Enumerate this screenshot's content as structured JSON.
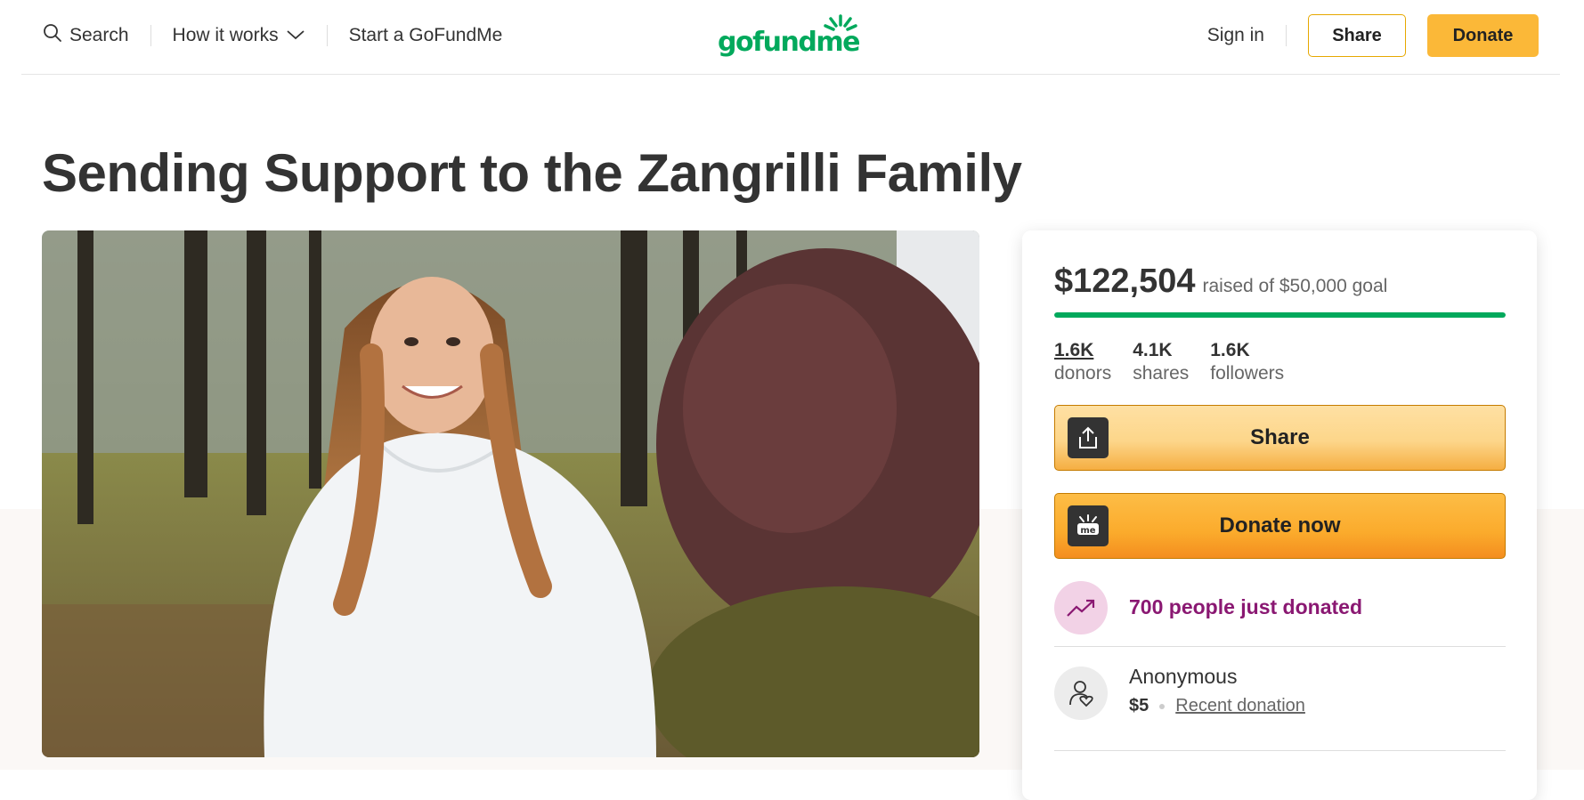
{
  "header": {
    "search_label": "Search",
    "how_it_works_label": "How it works",
    "start_label": "Start a GoFundMe",
    "logo_text": "gofundme",
    "signin_label": "Sign in",
    "share_label": "Share",
    "donate_label": "Donate"
  },
  "campaign": {
    "title": "Sending Support to the Zangrilli Family"
  },
  "card": {
    "amount_raised": "$122,504",
    "goal_text": "raised of $50,000 goal",
    "progress_fraction": 1.0,
    "progress_color": "#02a95c",
    "stats": [
      {
        "value": "1.6K",
        "label": "donors"
      },
      {
        "value": "4.1K",
        "label": "shares"
      },
      {
        "value": "1.6K",
        "label": "followers"
      }
    ],
    "share_button_label": "Share",
    "donate_button_label": "Donate now",
    "trend_text": "700 people just donated",
    "recent_donor": {
      "name": "Anonymous",
      "amount": "$5",
      "tag": "Recent donation"
    }
  },
  "colors": {
    "brand_green": "#02a95c",
    "donate_yellow": "#fbb838",
    "trend_purple": "#8a1872"
  },
  "icons": [
    "search-icon",
    "chevron-down-icon",
    "share-upload-icon",
    "gofundme-me-icon",
    "trending-up-icon",
    "donor-heart-icon"
  ]
}
